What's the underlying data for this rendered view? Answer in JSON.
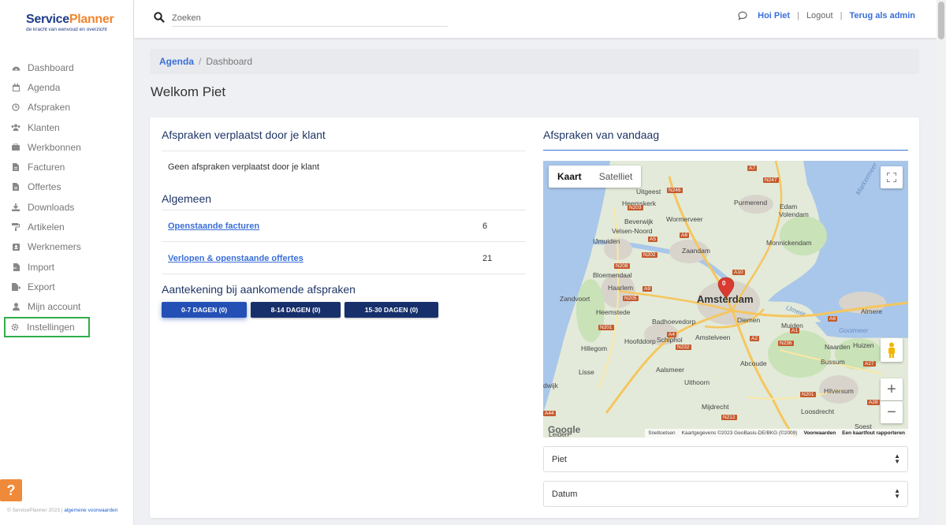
{
  "logo": {
    "part1": "Service",
    "part2": "Planner",
    "tagline": "de kracht van eenvoud en overzicht"
  },
  "sidebar": {
    "items": [
      {
        "label": "Dashboard",
        "icon": "dashboard-icon"
      },
      {
        "label": "Agenda",
        "icon": "calendar-icon"
      },
      {
        "label": "Afspraken",
        "icon": "clock-icon"
      },
      {
        "label": "Klanten",
        "icon": "users-icon"
      },
      {
        "label": "Werkbonnen",
        "icon": "briefcase-icon"
      },
      {
        "label": "Facturen",
        "icon": "document-icon"
      },
      {
        "label": "Offertes",
        "icon": "document-icon"
      },
      {
        "label": "Downloads",
        "icon": "download-icon"
      },
      {
        "label": "Artikelen",
        "icon": "paint-roller-icon"
      },
      {
        "label": "Werknemers",
        "icon": "id-badge-icon"
      },
      {
        "label": "Import",
        "icon": "file-import-icon"
      },
      {
        "label": "Export",
        "icon": "file-export-icon"
      },
      {
        "label": "Mijn account",
        "icon": "user-icon"
      },
      {
        "label": "Instellingen",
        "icon": "gear-icon",
        "active": true
      }
    ],
    "help_label": "?",
    "footer_text": "© ServicePlanner 2023 |",
    "footer_link": "algemene voorwaarden"
  },
  "topbar": {
    "search_placeholder": "Zoeken",
    "user_greeting": "Hoi Piet",
    "logout": "Logout",
    "back_as_admin": "Terug als admin",
    "sep": "|"
  },
  "breadcrumb": {
    "link": "Agenda",
    "sep": "/",
    "current": "Dashboard"
  },
  "page_title": "Welkom Piet",
  "moved": {
    "title": "Afspraken verplaatst door je klant",
    "empty": "Geen afspraken verplaatst door je klant"
  },
  "general": {
    "title": "Algemeen",
    "rows": [
      {
        "label": "Openstaande facturen",
        "value": "6"
      },
      {
        "label": "Verlopen & openstaande offertes",
        "value": "21"
      }
    ]
  },
  "notes": {
    "title": "Aantekening bij aankomende afspraken",
    "tabs": [
      "0-7 DAGEN (0)",
      "8-14 DAGEN (0)",
      "15-30 DAGEN (0)"
    ]
  },
  "today": {
    "title": "Afspraken van vandaag",
    "map": {
      "type_map": "Kaart",
      "type_satellite": "Satelliet",
      "marker_label": "0",
      "zoom_in": "+",
      "zoom_out": "−",
      "labels": {
        "uitgeest": "Uitgeest",
        "heemskerk": "Heemskerk",
        "purmerend": "Purmerend",
        "edam": "Edam",
        "volendam": "Volendam",
        "wormerveer": "Wormerveer",
        "beverwijk": "Beverwijk",
        "velsen": "Velsen-Noord",
        "ijmuiden": "IJmuiden",
        "monnickendam": "Monnickendam",
        "zaandam": "Zaandam",
        "bloemendaal": "Bloemendaal",
        "haarlem": "Haarlem",
        "zandvoort": "Zandvoort",
        "amsterdam": "Amsterdam",
        "almere": "Almere",
        "heemstede": "Heemstede",
        "badhoevedorp": "Badhoevedorp",
        "diemen": "Diemen",
        "muiden": "Muiden",
        "hoofddorp": "Hoofddorp",
        "schiphol": "Schiphol",
        "amstelveen": "Amstelveen",
        "hillegom": "Hillegom",
        "naarden": "Naarden",
        "huizen": "Huizen",
        "lisse": "Lisse",
        "aalsmeer": "Aalsmeer",
        "abcoude": "Abcoude",
        "bussum": "Bussum",
        "uithoorn": "Uithoorn",
        "hilversum": "Hilversum",
        "mijdrecht": "Mijdrecht",
        "loosdrecht": "Loosdrecht",
        "leiden": "Leiden",
        "soest": "Soest",
        "dwijk": "dwijk",
        "markermeer": "Markermeer",
        "gooimeer": "Gooimeer",
        "ijmeer": "IJmeer"
      },
      "roads": {
        "a7": "A7",
        "n247": "N247",
        "n246": "N246",
        "n203": "N203",
        "a8": "A8",
        "a5": "A5",
        "n202": "N202",
        "n208": "N208",
        "n205": "N205",
        "a9": "A9",
        "a10": "A10",
        "n201": "N201",
        "a4": "A4",
        "n232": "N232",
        "n236": "N236",
        "a6": "A6",
        "a1": "A1",
        "a2": "A2",
        "a27": "A27",
        "n212": "N212",
        "a44": "A44",
        "a28": "A28",
        "n201b": "N201"
      },
      "google": "Google",
      "attribution": {
        "shortcuts": "Sneltoetsen",
        "mapdata": "Kaartgegevens ©2023 GeoBasis-DE/BKG (©2009)",
        "terms": "Voorwaarden",
        "report": "Een kaartfout rapporteren"
      }
    },
    "select_employee": "Piet",
    "select_date": "Datum"
  },
  "colors": {
    "brand_blue": "#1f3c88",
    "brand_orange": "#f0862e",
    "link": "#3a6fd8",
    "active_outline": "#2fae4a",
    "button_dark": "#172f6b"
  }
}
